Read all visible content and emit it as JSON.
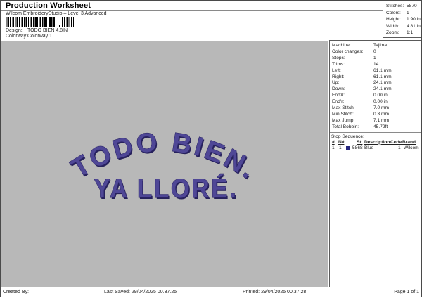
{
  "header": {
    "title": "Production Worksheet",
    "subtitle": "Wilcom EmbroideryStudio – Level 3 Advanced",
    "design_label": "Design:",
    "design_value": "TODO BIEN 4,8IN",
    "colorway_label": "Colorway:",
    "colorway_value": "Colorway 1"
  },
  "summary": {
    "rows": [
      {
        "label": "Stitches:",
        "value": "5870"
      },
      {
        "label": "Colors:",
        "value": "1"
      },
      {
        "label": "Height:",
        "value": "1.90 in"
      },
      {
        "label": "Width:",
        "value": "4.81 in"
      },
      {
        "label": "Zoom:",
        "value": "1:1"
      }
    ]
  },
  "machine": {
    "rows": [
      {
        "label": "Machine:",
        "value": "Tajima"
      },
      {
        "label": "Color changes:",
        "value": "0"
      },
      {
        "label": "Stops:",
        "value": "1"
      },
      {
        "label": "Trims:",
        "value": "14"
      },
      {
        "label": "Left:",
        "value": "61.1 mm"
      },
      {
        "label": "Right:",
        "value": "61.1 mm"
      },
      {
        "label": "Up:",
        "value": "24.1 mm"
      },
      {
        "label": "Down:",
        "value": "24.1 mm"
      },
      {
        "label": "EndX:",
        "value": "0.00 in"
      },
      {
        "label": "EndY:",
        "value": "0.00 in"
      },
      {
        "label": "Max Stitch:",
        "value": "7.0 mm"
      },
      {
        "label": "Min Stitch:",
        "value": "0.3 mm"
      },
      {
        "label": "Max Jump:",
        "value": "7.1 mm"
      },
      {
        "label": "Total Bobbin:",
        "value": "45.72ft"
      }
    ]
  },
  "stop_sequence": {
    "title": "Stop Sequence:",
    "headers": {
      "num": "#",
      "n": "N#",
      "st": "St.",
      "description": "Description",
      "code": "Code",
      "brand": "Brand"
    },
    "row": {
      "num": "1.",
      "n": "1",
      "swatch_color": "#26267e",
      "st": "5868",
      "description": "Blue",
      "code": "1",
      "brand": "Wilcom"
    }
  },
  "design": {
    "line1": "TODO BIEN.",
    "line2": "YA LLORÉ.",
    "thread_color": "#4f4796",
    "thread_dark": "#27215c",
    "canvas_color": "#b8b8b8"
  },
  "footer": {
    "created_by": "Created By:",
    "last_saved": "Last Saved: 29/04/2025 00.37.25",
    "printed": "Printed: 29/04/2025 00.37.28",
    "page": "Page 1 of 1"
  }
}
